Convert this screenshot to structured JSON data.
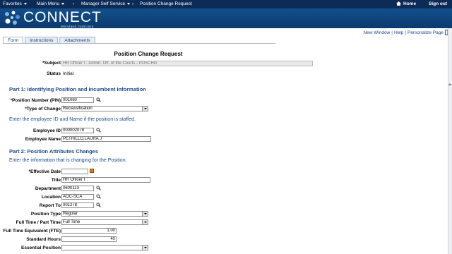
{
  "nav": {
    "favorites": "Favorites",
    "main_menu": "Main Menu",
    "breadcrumb1": "Manager Self Service",
    "breadcrumb2": "Position Change Request",
    "home": "Home",
    "signout": "Sign out"
  },
  "banner": {
    "logo": "CONNECT",
    "sub": "Maryland Judiciary"
  },
  "links": {
    "new_window": "New Window",
    "help": "Help",
    "personalize": "Personalize Page"
  },
  "tabs": [
    "Form",
    "Instructions",
    "Attachments"
  ],
  "page": {
    "title": "Position Change Request"
  },
  "header_fields": {
    "subject_label": "*Subject",
    "subject_value": "HR Officer I - Admin. Off. of the Courts - POSCHG",
    "status_label": "Status",
    "status_value": "Initial"
  },
  "part1": {
    "heading": "Part 1: Identifying Position and Incumbent Information",
    "pin_label": "*Position Number (PIN)",
    "pin_value": "001080",
    "type_label": "*Type of Change",
    "type_value": "Reclassification",
    "info": "Enter the employee ID and Name if the position is staffed.",
    "empid_label": "Employee ID",
    "empid_value": "000002078",
    "empname_label": "Employee Name",
    "empname_value": "PETRILLO,LAURA J"
  },
  "part2": {
    "heading": "Part 2: Position Attributes Changes",
    "info": "Enter the information that is changing for the Position.",
    "effdate_label": "*Effective Date",
    "effdate_value": "",
    "title_label": "Title",
    "title_value": "HR Officer I",
    "dept_label": "Department",
    "dept_value": "0600113",
    "loc_label": "Location",
    "loc_value": "AOC-SCA",
    "reports_label": "Report To",
    "reports_value": "001278",
    "ptype_label": "Position Type",
    "ptype_value": "Regular",
    "ftpt_label": "Full Time / Part Time",
    "ftpt_value": "Full Time",
    "fte_label": "Full Time Equivalent (FTE)",
    "fte_value": "1.00",
    "hours_label": "Standard Hours",
    "hours_value": "40",
    "essential_label": "Essential Position",
    "essential_value": ""
  },
  "colors": {
    "nav": "#0d2b57",
    "banner": "#124f8b",
    "heading": "#1a4a8a"
  }
}
